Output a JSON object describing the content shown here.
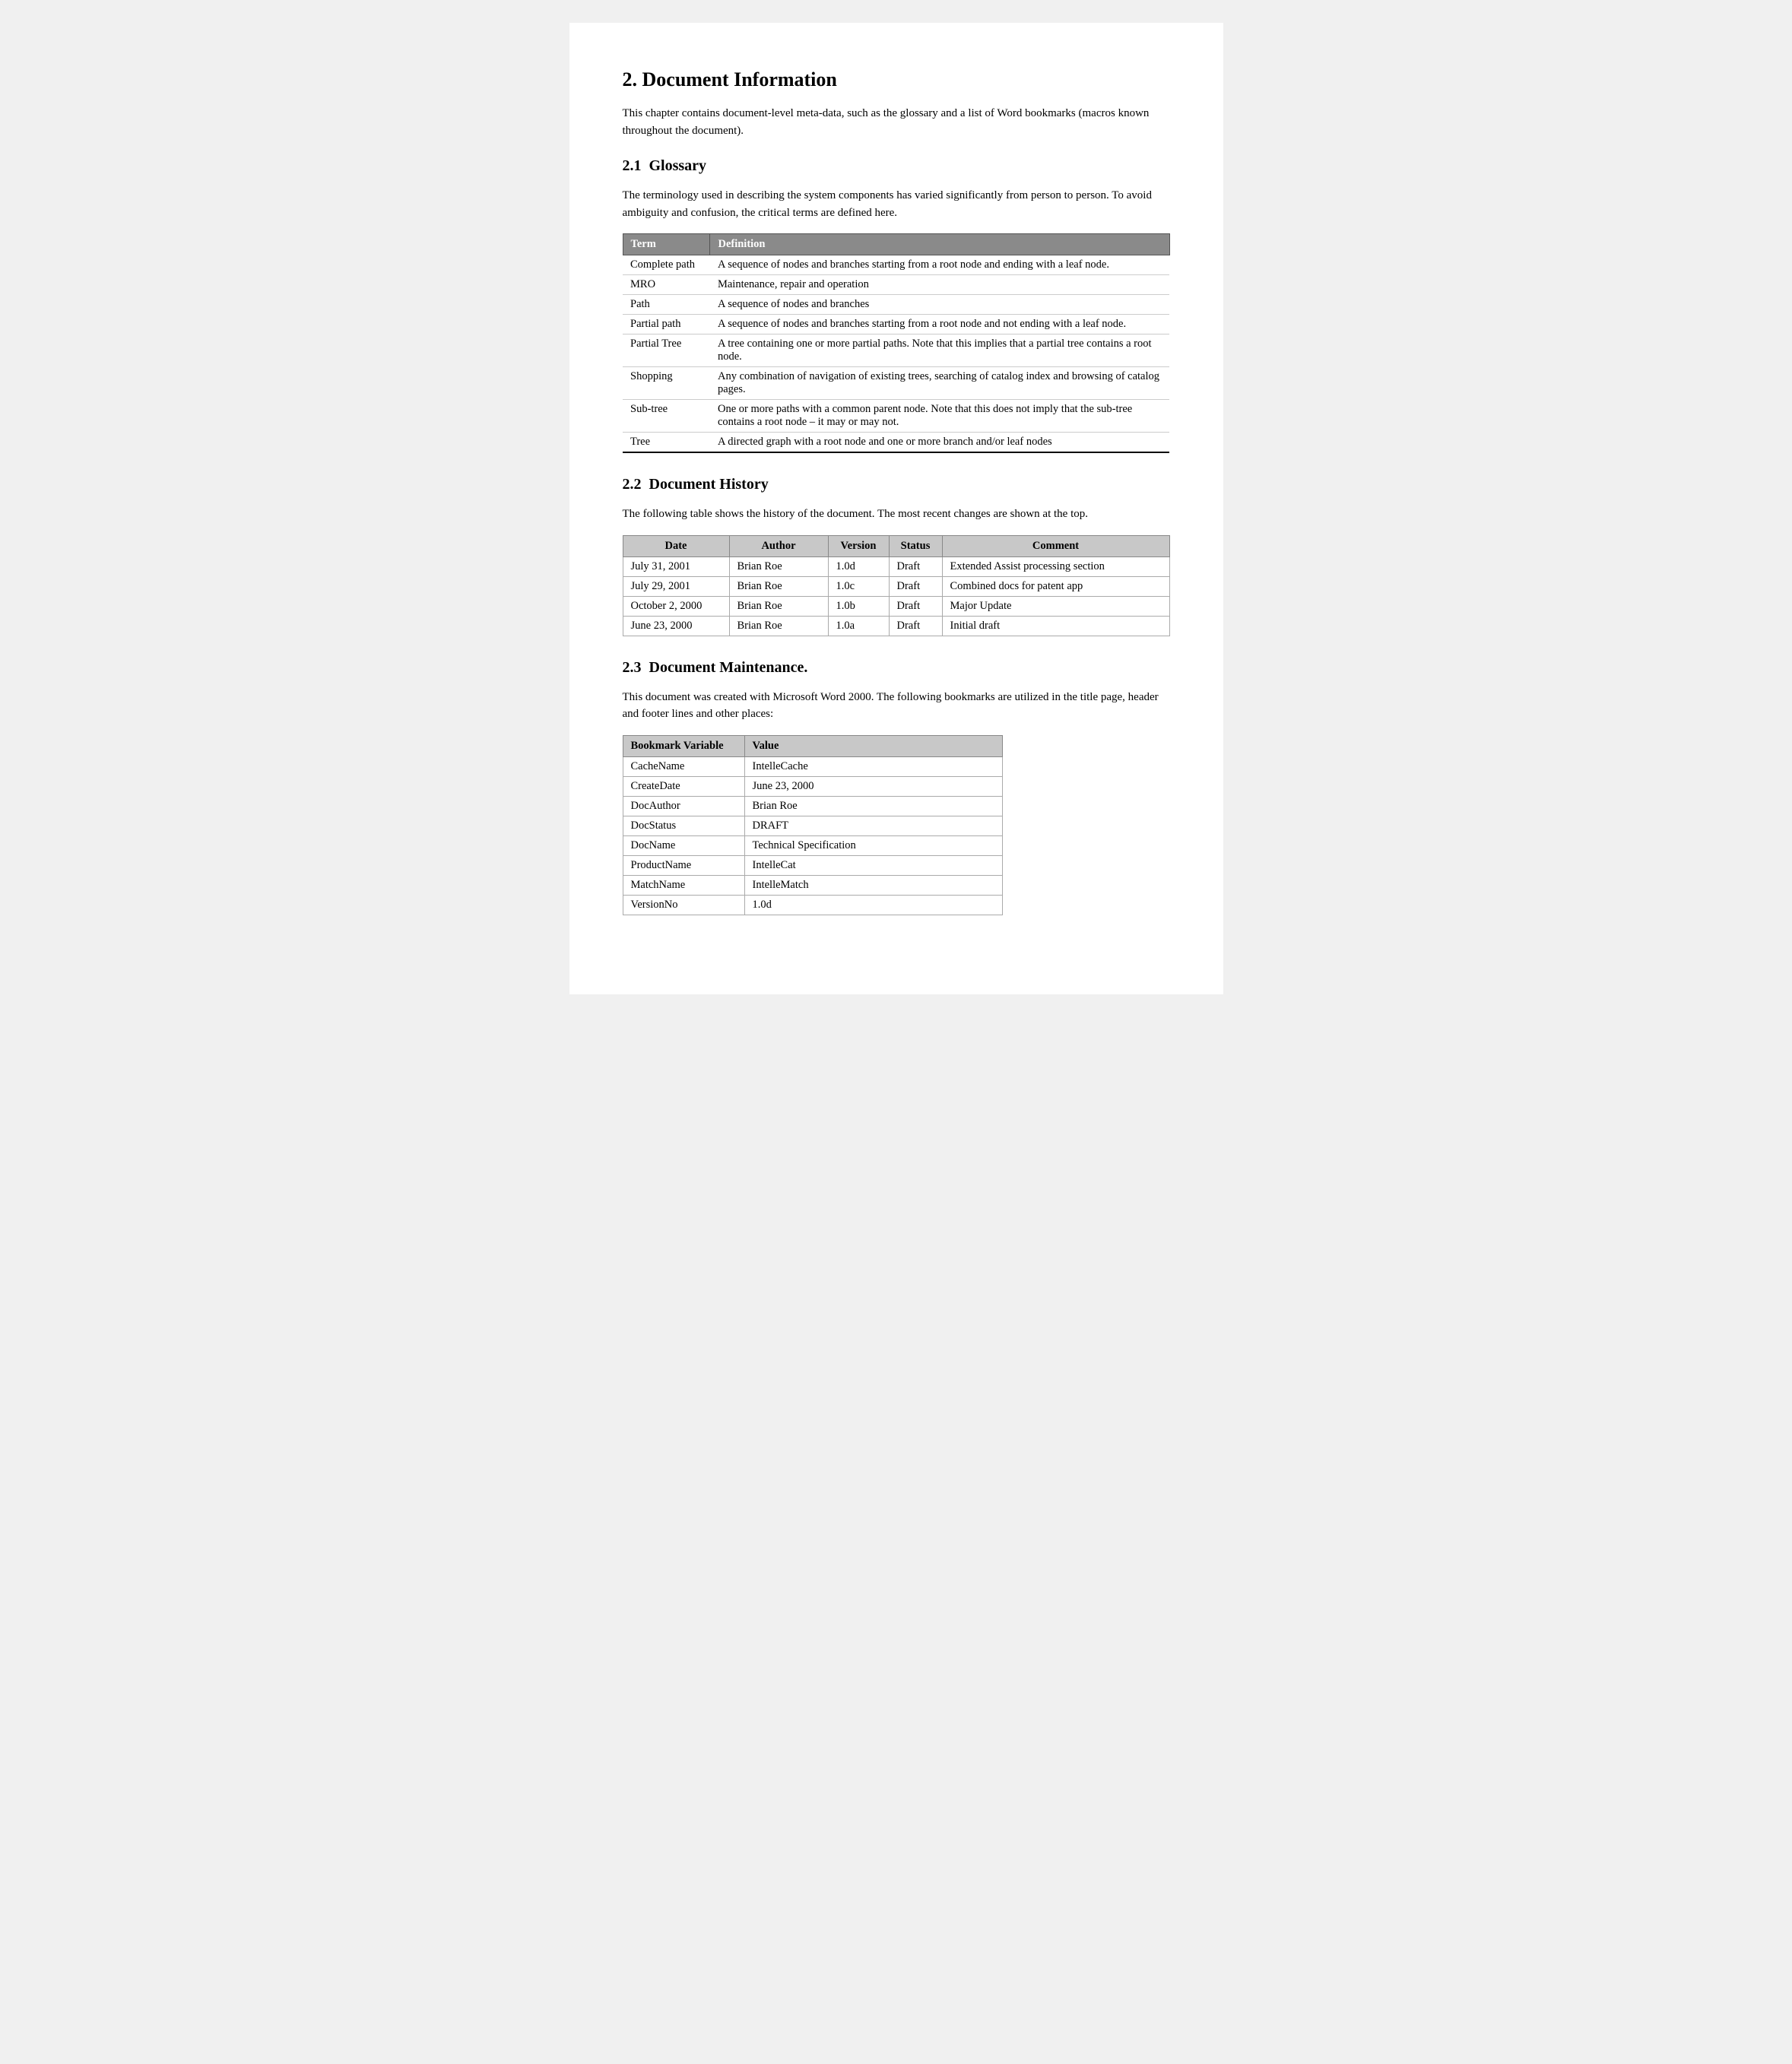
{
  "page": {
    "section2": {
      "number": "2.",
      "title": "Document Information",
      "intro": "This chapter contains document-level meta-data, such as the glossary and a list of Word bookmarks (macros known throughout the document)."
    },
    "section2_1": {
      "number": "2.1",
      "title": "Glossary",
      "intro": "The terminology used in describing the system components has varied significantly from person to person.  To avoid ambiguity and confusion, the critical terms are defined here.",
      "table": {
        "headers": [
          "Term",
          "Definition"
        ],
        "rows": [
          [
            "Complete path",
            "A sequence of nodes and branches starting from a root node and ending with a leaf node."
          ],
          [
            "MRO",
            "Maintenance, repair and operation"
          ],
          [
            "Path",
            "A sequence of nodes and branches"
          ],
          [
            "Partial path",
            "A sequence of nodes and branches starting from a root node and not ending with a leaf node."
          ],
          [
            "Partial Tree",
            "A tree containing one or more partial paths.  Note that this implies that a partial tree contains a root node."
          ],
          [
            "Shopping",
            "Any combination of navigation of existing trees, searching of catalog index and browsing of catalog pages."
          ],
          [
            "Sub-tree",
            "One or more paths with a common parent node.  Note that this does not imply that the sub-tree contains a root node – it may or may not."
          ],
          [
            "Tree",
            "A directed graph with a root node and one or more branch and/or leaf nodes"
          ]
        ]
      }
    },
    "section2_2": {
      "number": "2.2",
      "title": "Document History",
      "intro": "The following table shows the history of the document.  The most recent changes are shown at the top.",
      "table": {
        "headers": [
          "Date",
          "Author",
          "Version",
          "Status",
          "Comment"
        ],
        "rows": [
          [
            "July 31, 2001",
            "Brian Roe",
            "1.0d",
            "Draft",
            "Extended Assist processing section"
          ],
          [
            "July 29, 2001",
            "Brian Roe",
            "1.0c",
            "Draft",
            "Combined docs for patent app"
          ],
          [
            "October 2, 2000",
            "Brian Roe",
            "1.0b",
            "Draft",
            "Major Update"
          ],
          [
            "June 23, 2000",
            "Brian Roe",
            "1.0a",
            "Draft",
            "Initial draft"
          ]
        ]
      }
    },
    "section2_3": {
      "number": "2.3",
      "title": "Document Maintenance.",
      "intro": "This document was created with Microsoft Word 2000. The following bookmarks are utilized in the title page, header and footer lines and other places:",
      "table": {
        "headers": [
          "Bookmark Variable",
          "Value"
        ],
        "rows": [
          [
            "CacheName",
            "IntelleCache"
          ],
          [
            "CreateDate",
            "June 23, 2000"
          ],
          [
            "DocAuthor",
            "Brian Roe"
          ],
          [
            "DocStatus",
            "DRAFT"
          ],
          [
            "DocName",
            "Technical Specification"
          ],
          [
            "ProductName",
            "IntelleCat"
          ],
          [
            "MatchName",
            "IntelleMatch"
          ],
          [
            "VersionNo",
            "1.0d"
          ]
        ]
      }
    }
  }
}
